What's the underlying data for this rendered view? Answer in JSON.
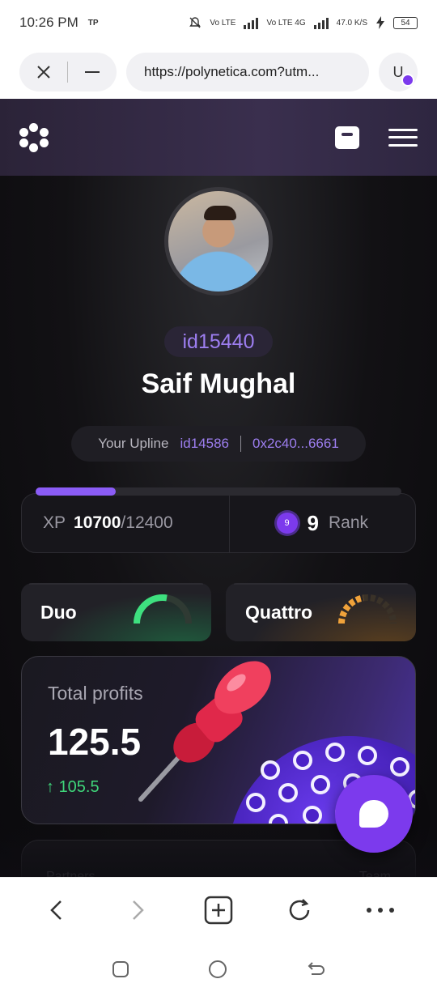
{
  "status_bar": {
    "time": "10:26 PM",
    "carrier_tag": "TP",
    "network_1": "Vo LTE",
    "network_2": "Vo LTE 4G",
    "speed": "47.0 K/S",
    "battery": "54"
  },
  "browser": {
    "url": "https://polynetica.com?utm...",
    "user_initial": "U"
  },
  "profile": {
    "user_id": "id15440",
    "name": "Saif Mughal",
    "upline_label": "Your Upline",
    "upline_id": "id14586",
    "upline_address": "0x2c40...6661"
  },
  "xp": {
    "label": "XP",
    "current": "10700",
    "separator": "/",
    "target": "12400",
    "progress_fraction": 0.22,
    "rank_badge": "9",
    "rank_value": "9",
    "rank_label": "Rank"
  },
  "programs": [
    {
      "name": "Duo",
      "color": "#3ee07f",
      "track_color": "#2f3a33",
      "fill_fraction": 0.55
    },
    {
      "name": "Quattro",
      "color": "#f0a23a",
      "track_color": "#3a3228",
      "fill_fraction": 0.45
    }
  ],
  "profits": {
    "title": "Total profits",
    "value": "125.5",
    "delta_arrow": "↑",
    "delta": "105.5"
  },
  "partners_card": {
    "left_label": "Partners",
    "right_label": "Team"
  },
  "colors": {
    "accent": "#8b5cf6",
    "id_text": "#9d7ef0",
    "positive": "#3fd67a"
  },
  "icons": {
    "close": "close-icon",
    "minimize": "minus-icon",
    "logo": "polynetica-logo",
    "wallet": "wallet-icon",
    "menu": "hamburger-menu-icon",
    "chat": "chat-bubble-icon",
    "back": "chevron-left-icon",
    "forward": "chevron-right-icon",
    "tabs": "add-tab-icon",
    "reload": "reload-icon",
    "more": "more-dots-icon"
  }
}
